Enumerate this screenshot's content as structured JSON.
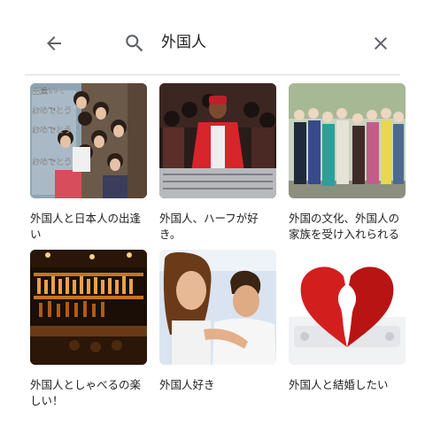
{
  "search": {
    "query": "外国人",
    "back_icon": "arrow-left-icon",
    "search_icon": "search-icon",
    "clear_icon": "close-icon"
  },
  "results": [
    {
      "caption": "外国人と日本人の出逢い",
      "overlay_text": [
        "出逢いへ",
        "おめでとう",
        "おめでとう",
        "おめでとう"
      ]
    },
    {
      "caption": "外国人、ハーフが好き。"
    },
    {
      "caption": "外国の文化、外国人の家族を受け入れられる"
    },
    {
      "caption": "外国人としゃべるの楽しい！"
    },
    {
      "caption": "外国人好き"
    },
    {
      "caption": "外国人と結婚したい"
    }
  ],
  "colors": {
    "divider": "#dadce0",
    "icon": "#5f6368",
    "heart": "#d31e1e"
  }
}
